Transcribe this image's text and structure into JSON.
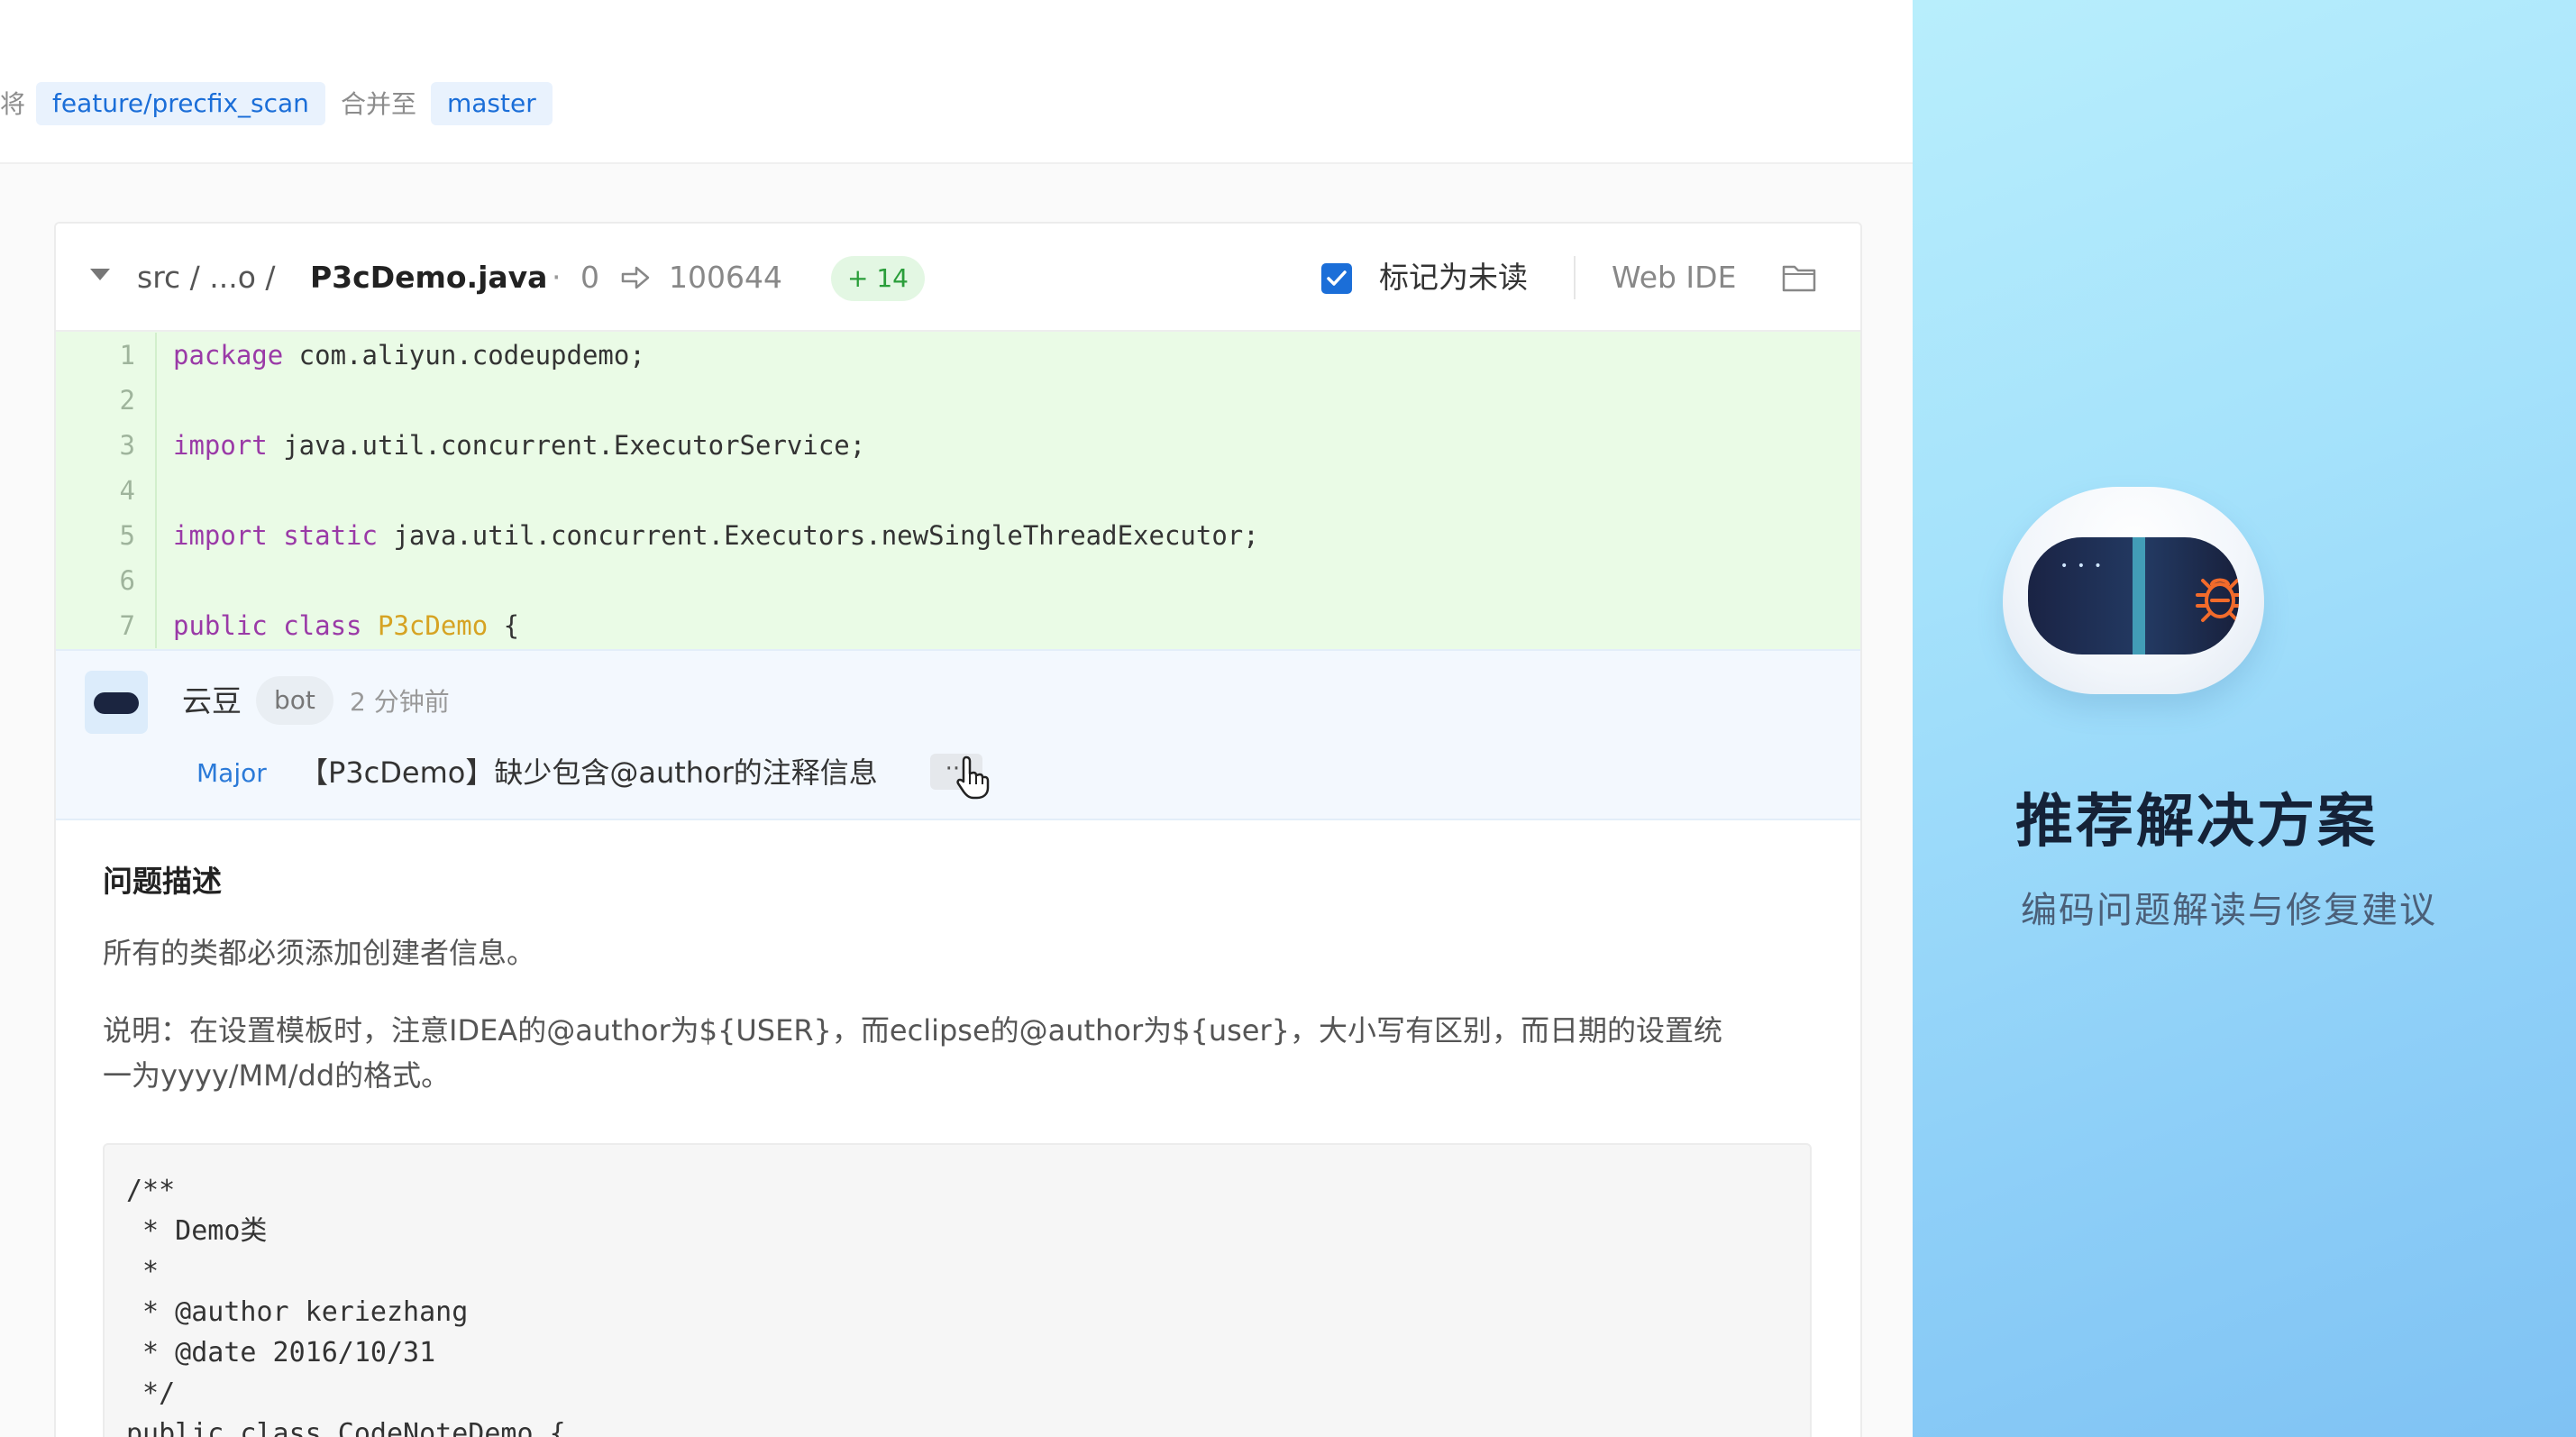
{
  "merge_bar": {
    "prefix": "将",
    "source_branch": "feature/precfix_scan",
    "middle": "合并至",
    "target_branch": "master"
  },
  "file_header": {
    "path": "src /  ...o /",
    "filename": "P3cDemo.java",
    "separator": "·",
    "old_mode": "0",
    "new_mode": "100644",
    "additions": "+ 14",
    "mark_unread_label": "标记为未读",
    "mark_unread_checked": true,
    "web_ide_label": "Web IDE"
  },
  "code_lines": [
    {
      "number": "1",
      "tokens": [
        {
          "t": "package",
          "c": "kw"
        },
        {
          "t": " com.aliyun.codeupdemo;",
          "c": ""
        }
      ]
    },
    {
      "number": "2",
      "tokens": []
    },
    {
      "number": "3",
      "tokens": [
        {
          "t": "import",
          "c": "kw"
        },
        {
          "t": " java.util.concurrent.ExecutorService;",
          "c": ""
        }
      ]
    },
    {
      "number": "4",
      "tokens": []
    },
    {
      "number": "5",
      "tokens": [
        {
          "t": "import static",
          "c": "kw"
        },
        {
          "t": " java.util.concurrent.Executors.newSingleThreadExecutor;",
          "c": ""
        }
      ]
    },
    {
      "number": "6",
      "tokens": []
    },
    {
      "number": "7",
      "tokens": [
        {
          "t": "public class",
          "c": "kw"
        },
        {
          "t": " ",
          "c": ""
        },
        {
          "t": "P3cDemo",
          "c": "cls"
        },
        {
          "t": " {",
          "c": ""
        }
      ]
    }
  ],
  "comment": {
    "author": "云豆",
    "tag": "bot",
    "time": "2 分钟前",
    "severity": "Major",
    "message": "【P3cDemo】缺少包含@author的注释信息",
    "more_label": "···"
  },
  "detail": {
    "title": "问题描述",
    "para1": "所有的类都必须添加创建者信息。",
    "para2_line1": "说明：在设置模板时，注意IDEA的@author为${USER}，而eclipse的@author为${user}，大小写有区别，而日期的设置统",
    "para2_line2": "一为yyyy/MM/dd的格式。",
    "code_sample": "/**\n * Demo类\n *\n * @author keriezhang\n * @date 2016/10/31\n */\npublic class CodeNoteDemo {"
  },
  "promo": {
    "title": "推荐解决方案",
    "subtitle": "编码问题解读与修复建议"
  },
  "colors": {
    "accent": "#1b6ed8",
    "added_bg": "#eafbe6",
    "promo_title": "#152237",
    "bug_orange": "#f26b2b"
  }
}
